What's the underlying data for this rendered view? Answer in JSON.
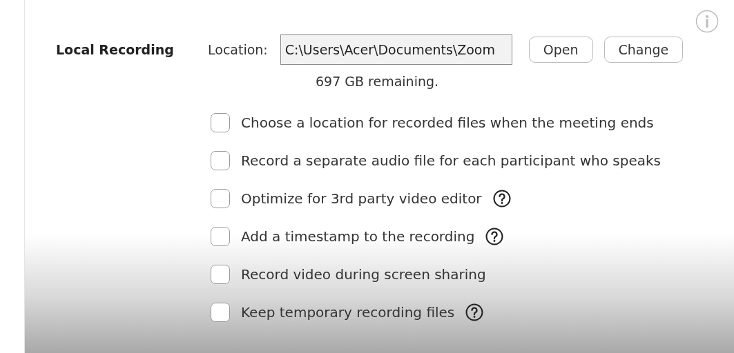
{
  "section": {
    "title": "Local Recording"
  },
  "location": {
    "label": "Location:",
    "value": "C:\\Users\\Acer\\Documents\\Zoom"
  },
  "buttons": [
    "Open",
    "Change"
  ],
  "space_note": "697 GB remaining.",
  "options": [
    {
      "label": "Choose a location for recorded files when the meeting ends",
      "checked": false,
      "help": false
    },
    {
      "label": "Record a separate audio file for each participant who speaks",
      "checked": false,
      "help": false
    },
    {
      "label": "Optimize for 3rd party video editor",
      "checked": false,
      "help": true
    },
    {
      "label": "Add a timestamp to the recording",
      "checked": false,
      "help": true
    },
    {
      "label": "Record video during screen sharing",
      "checked": false,
      "help": false
    },
    {
      "label": "Keep temporary recording files",
      "checked": false,
      "help": true
    }
  ]
}
